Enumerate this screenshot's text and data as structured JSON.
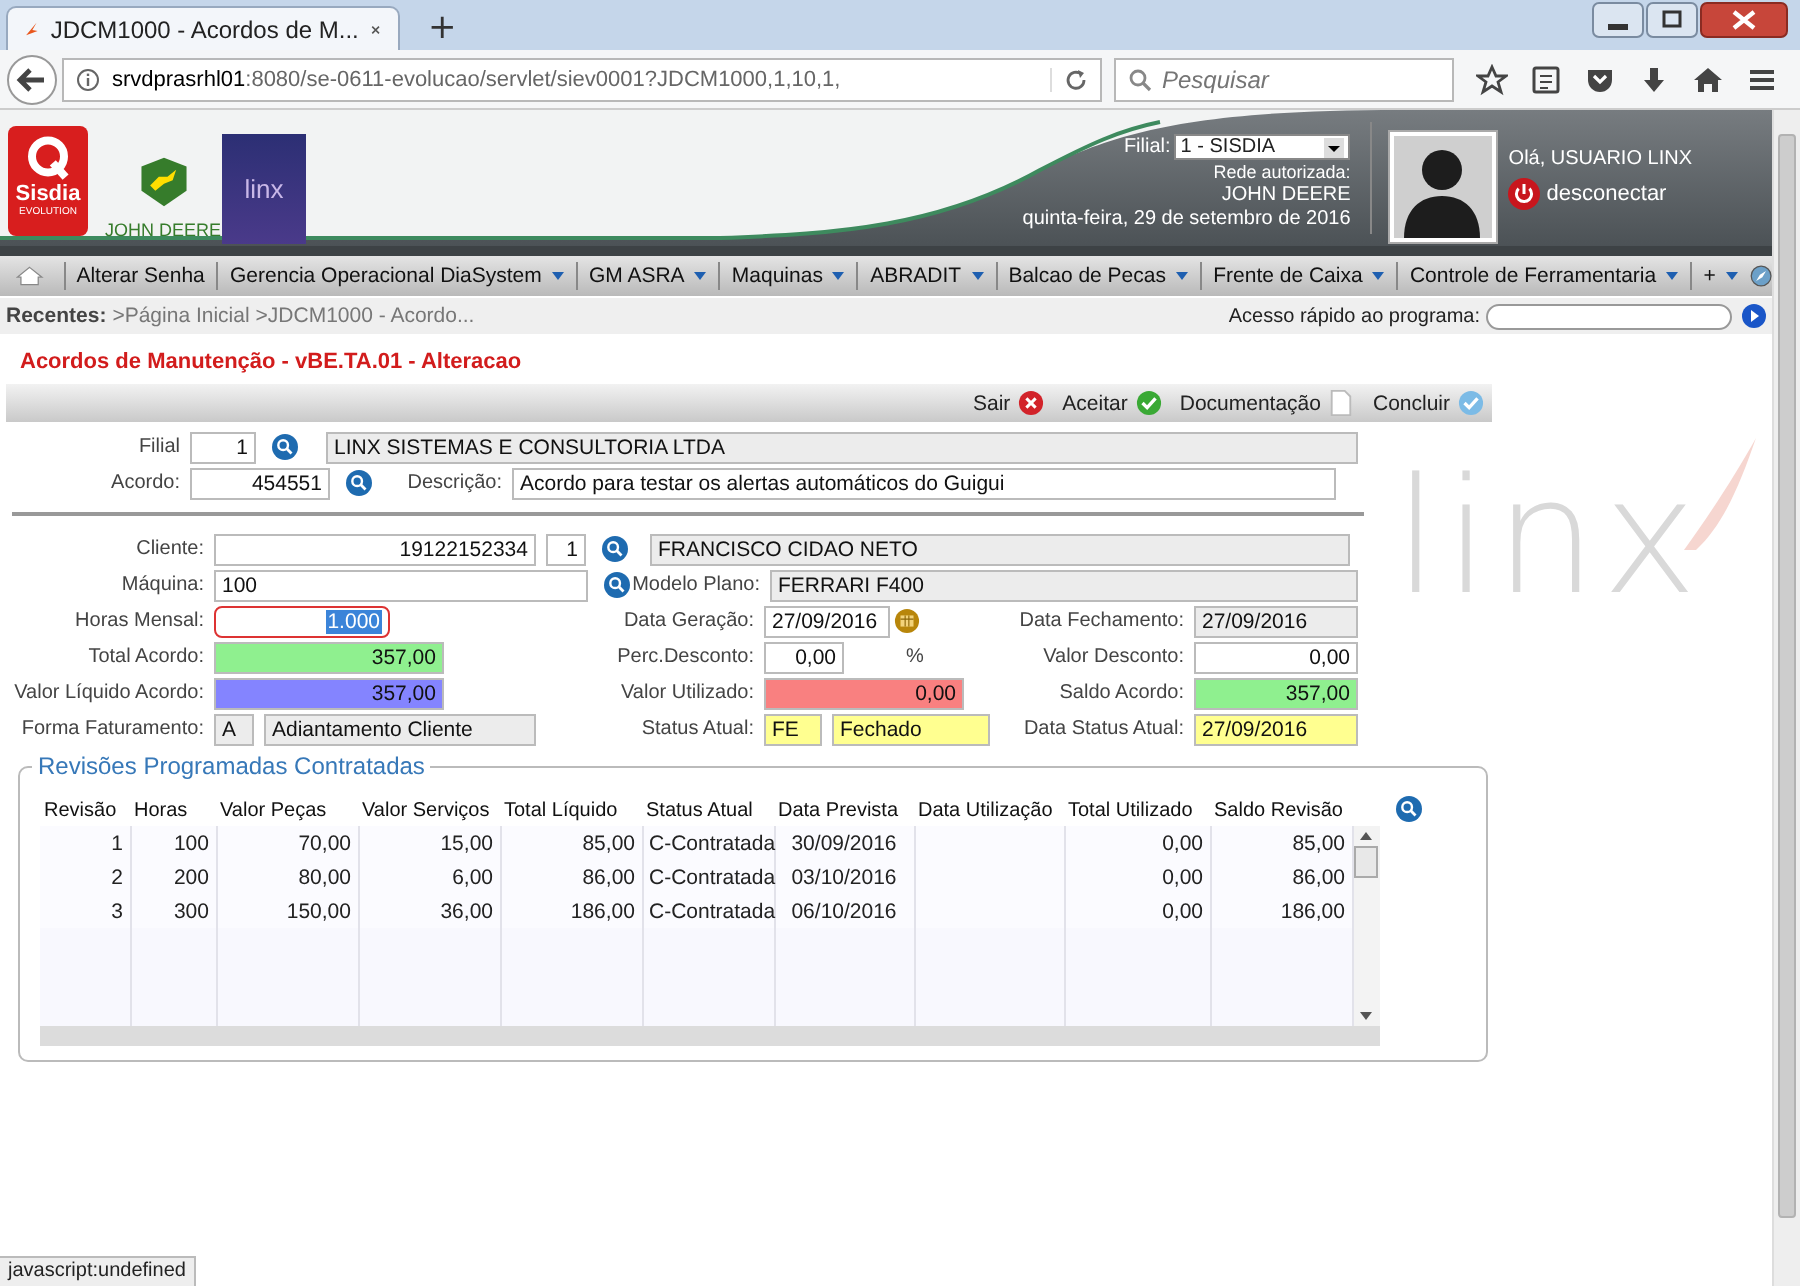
{
  "browser": {
    "tab_title": "JDCM1000 - Acordos de M...",
    "new_tab": "+",
    "url_host": "srvdprasrhl01",
    "url_path": ":8080/se-0611-evolucao/servlet/siev0001?JDCM1000,1,10,1,",
    "search_placeholder": "Pesquisar",
    "status_text": "javascript:undefined"
  },
  "header": {
    "logo_text": "Sisdia",
    "logo_subtext": "EVOLUTION",
    "brand_text": "JOHN DEERE",
    "partner_text": "linx",
    "filial_label": "Filial:",
    "filial_value": "1 - SISDIA",
    "network_label": "Rede autorizada:",
    "network_value": "JOHN DEERE",
    "date": "quinta-feira, 29 de setembro de 2016",
    "greeting": "Olá, USUARIO LINX",
    "logout": "desconectar"
  },
  "menu": [
    {
      "label": "Alterar Senha",
      "dropdown": false
    },
    {
      "label": "Gerencia Operacional DiaSystem",
      "dropdown": true
    },
    {
      "label": "GM ASRA",
      "dropdown": true
    },
    {
      "label": "Maquinas",
      "dropdown": true
    },
    {
      "label": "ABRADIT",
      "dropdown": true
    },
    {
      "label": "Balcao de Pecas",
      "dropdown": true
    },
    {
      "label": "Frente de Caixa",
      "dropdown": true
    },
    {
      "label": "Controle de Ferramentaria",
      "dropdown": true
    },
    {
      "label": "+",
      "dropdown": true
    }
  ],
  "recents": {
    "label": "Recentes:",
    "items": [
      ">Página Inicial",
      ">JDCM1000 - Acordo..."
    ],
    "quick_label": "Acesso rápido ao programa:"
  },
  "page_title": "Acordos de Manutenção - vBE.TA.01 - Alteracao",
  "watermark": "linx",
  "actions": [
    {
      "label": "Sair",
      "kind": "exit"
    },
    {
      "label": "Aceitar",
      "kind": "accept"
    },
    {
      "label": "Documentação",
      "kind": "doc"
    },
    {
      "label": "Concluir",
      "kind": "finish"
    }
  ],
  "agreement": {
    "filial_label": "Filial",
    "filial_code": "1",
    "filial_name": "LINX SISTEMAS E CONSULTORIA LTDA",
    "acordo_label": "Acordo:",
    "acordo_value": "454551",
    "desc_label": "Descrição:",
    "desc_value": "Acordo para testar os alertas automáticos do Guigui"
  },
  "client": {
    "label": "Cliente:",
    "code": "19122152334",
    "seq": "1",
    "name": "FRANCISCO CIDAO NETO",
    "machine_label": "Máquina:",
    "machine_value": "100",
    "model_label": "Modelo Plano:",
    "model_value": "FERRARI F400"
  },
  "fields": [
    [
      {
        "label": "Horas Mensal:",
        "boxes": [
          {
            "text": "1.000",
            "kind": "focused"
          }
        ]
      },
      {
        "label": "Data Geração:",
        "boxes": [
          {
            "text": "27/09/2016",
            "kind": "date"
          }
        ]
      },
      {
        "label": "Data Fechamento:",
        "boxes": [
          {
            "text": "27/09/2016",
            "kind": "readonly"
          }
        ]
      }
    ],
    [
      {
        "label": "Total Acordo:",
        "boxes": [
          {
            "text": "357,00",
            "kind": "green"
          }
        ]
      },
      {
        "label": "Perc.Desconto:",
        "boxes": [
          {
            "text": "0,00",
            "kind": "input"
          }
        ],
        "suffix": "%"
      },
      {
        "label": "Valor Desconto:",
        "boxes": [
          {
            "text": "0,00",
            "kind": "input"
          }
        ]
      }
    ],
    [
      {
        "label": "Valor Líquido Acordo:",
        "boxes": [
          {
            "text": "357,00",
            "kind": "blue"
          }
        ]
      },
      {
        "label": "Valor Utilizado:",
        "boxes": [
          {
            "text": "0,00",
            "kind": "red"
          }
        ]
      },
      {
        "label": "Saldo Acordo:",
        "boxes": [
          {
            "text": "357,00",
            "kind": "green"
          }
        ]
      }
    ],
    [
      {
        "label": "Forma Faturamento:",
        "boxes": [
          {
            "text": "A",
            "kind": "readonly"
          },
          {
            "text": "Adiantamento Cliente",
            "kind": "readonly"
          }
        ]
      },
      {
        "label": "Status Atual:",
        "boxes": [
          {
            "text": "FE",
            "kind": "yellow"
          },
          {
            "text": "Fechado",
            "kind": "yellow"
          }
        ]
      },
      {
        "label": "Data Status Atual:",
        "boxes": [
          {
            "text": "27/09/2016",
            "kind": "yellow"
          }
        ]
      }
    ]
  ],
  "table": {
    "title": "Revisões Programadas Contratadas",
    "columns": [
      "Revisão",
      "Horas",
      "Valor Peças",
      "Valor Serviços",
      "Total Líquido",
      "Status Atual",
      "Data Prevista",
      "Data Utilização",
      "Total Utilizado",
      "Saldo Revisão"
    ],
    "rows": [
      [
        "1",
        "100",
        "70,00",
        "15,00",
        "85,00",
        "C-Contratada",
        "30/09/2016",
        null,
        "0,00",
        "85,00"
      ],
      [
        "2",
        "200",
        "80,00",
        "6,00",
        "86,00",
        "C-Contratada",
        "03/10/2016",
        null,
        "0,00",
        "86,00"
      ],
      [
        "3",
        "300",
        "150,00",
        "36,00",
        "186,00",
        "C-Contratada",
        "06/10/2016",
        null,
        "0,00",
        "186,00"
      ]
    ]
  }
}
